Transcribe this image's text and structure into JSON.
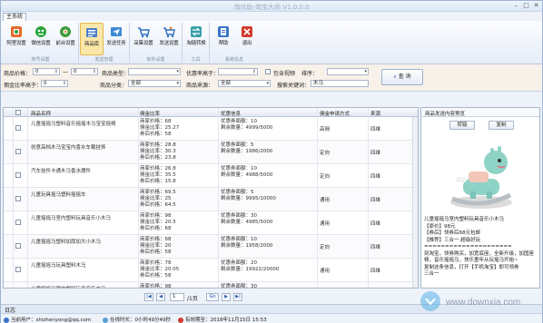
{
  "window": {
    "title": "淘优助-淘宝大师 V1.0.0.0",
    "min": "–",
    "max": "□",
    "close": "✕"
  },
  "ribbon": {
    "tab": "主系统",
    "groups": [
      {
        "label": "账号设置",
        "buttons": [
          "阿里设置",
          "微信设置",
          "前台设置"
        ]
      },
      {
        "label": "发送管理",
        "buttons": [
          "商品库",
          "发送任务"
        ]
      },
      {
        "label": "软件设置",
        "buttons": [
          "采集设置",
          "发送设置"
        ]
      },
      {
        "label": "工具",
        "buttons": [
          "淘链转换"
        ]
      },
      {
        "label": "系统信息",
        "buttons": [
          "帮助",
          "退出"
        ]
      }
    ]
  },
  "filters": {
    "price_label": "商品价格：",
    "price_min": "0",
    "sep": "—",
    "price_max": "0",
    "type_label": "商品类型：",
    "type_value": "",
    "coupon_label": "优惠率高于：",
    "coupon_value": "",
    "video_label": "包含视频",
    "sort_label": "排序：",
    "sort_value": "",
    "commission_label": "佣金比率高于：",
    "commission_value": "0",
    "category_label": "商品分类：",
    "category_value": "全部",
    "source_label": "商品来源：",
    "source_value": "全部",
    "keyword_label": "搜索关键词：",
    "keyword_value": "木马",
    "query_button": "查 询"
  },
  "table": {
    "headers": [
      "商品名称",
      "佣金比率",
      "优惠信息",
      "佣金申请方式",
      "来源"
    ],
    "rows": [
      {
        "name": "儿童摇摇马塑料音乐摇摇木马宝宝摇椅",
        "price": "商家价格：68",
        "rate": "佣金比率：25.27",
        "comm": "券后价格：58",
        "coupon": "优惠券面额：10",
        "remain": "剩余数量：4999/5000",
        "apply": "高佣",
        "src": "四维"
      },
      {
        "name": "创意高档木马宝宝内香水车载挂饰",
        "price": "商家价格：28.8",
        "rate": "佣金比率：30.3",
        "comm": "券后价格：23.8",
        "coupon": "优惠券面额：5",
        "remain": "剩余数量：1986/2000",
        "apply": "定向",
        "src": "四维"
      },
      {
        "name": "汽车挂件卡通木马香水摆件",
        "price": "商家价格：26.8",
        "rate": "佣金比率：35.5",
        "comm": "券后价格：15.8",
        "coupon": "优惠券面额：10",
        "remain": "剩余数量：4988/5000",
        "apply": "定向",
        "src": "四维"
      },
      {
        "name": "儿童玩具摇马塑料摇摇车",
        "price": "商家价格：69.5",
        "rate": "佣金比率：25",
        "comm": "券后价格：64.5",
        "coupon": "优惠券面额：5",
        "remain": "剩余数量：9995/10000",
        "apply": "通用",
        "src": "四维"
      },
      {
        "name": "儿童摇摇马室内塑料玩具音乐小木马",
        "price": "商家价格：98",
        "rate": "佣金比率：20.5",
        "comm": "券后价格：68",
        "coupon": "优惠券面额：30",
        "remain": "剩余数量：4985/5000",
        "apply": "通用",
        "src": "四维"
      },
      {
        "name": "儿童摇摇马塑料加厚加大小木马",
        "price": "商家价格：68",
        "rate": "佣金比率：20",
        "comm": "券后价格：58",
        "coupon": "优惠券面额：10",
        "remain": "剩余数量：1958/2000",
        "apply": "定向",
        "src": "四维"
      },
      {
        "name": "儿童摇摇马玩具塑料木马",
        "price": "商家价格：78",
        "rate": "佣金比率：20.05",
        "comm": "券后价格：58",
        "coupon": "优惠券面额：20",
        "remain": "剩余数量：19922/20000",
        "apply": "通用",
        "src": "四维"
      },
      {
        "name": "儿童摇摇马室内塑料玩具音乐木马",
        "price": "商家价格：98",
        "rate": "佣金比率：20",
        "comm": "券后价格：68",
        "coupon": "优惠券面额：30",
        "remain": "剩余数量：4899/5000",
        "apply": "通用",
        "src": "四维"
      }
    ]
  },
  "side": {
    "header": "商品发送内容预览",
    "btn_convert": "转链",
    "btn_copy": "复制",
    "lines": [
      "儿童摇摇马室内塑料玩具音乐小木马",
      "【原价】98元",
      "【券后】领券后68元包邮",
      "【推荐】三合一 超级好玩",
      "=====================",
      "到淘宝，领券购买，加宽底座，全新升级，加固座",
      "椅，音乐摇摇马，快乐童年从玩摇马开始~",
      "复制这条信息，打开【手机淘宝】即可领券"
    ],
    "tail": "三合一"
  },
  "pager": {
    "first": "|◀",
    "prev": "◀",
    "page": "1",
    "of": "/1页",
    "go": "Go",
    "next": "▶",
    "last": "▶|"
  },
  "logbar": {
    "label": "日志"
  },
  "status": {
    "account": "当前用户：shizhenyong@qq.com",
    "online": "在线时长：0小时49分49秒",
    "expiry": "有效期至：2018年11月15日 15:53"
  },
  "watermark": {
    "text": "www.downxia.com"
  },
  "colors": {
    "accent": "#2a5aa8",
    "selected_tab": "#fbe7a8"
  }
}
